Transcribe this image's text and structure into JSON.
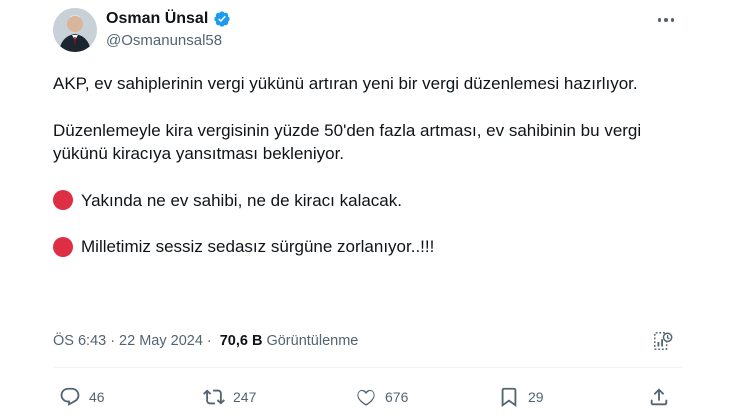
{
  "author": {
    "name": "Osman Ünsal",
    "handle": "@Osmanunsal58"
  },
  "tweet": {
    "paragraphs": [
      "AKP, ev sahiplerinin vergi yükünü artıran yeni bir vergi düzenlemesi hazırlıyor.",
      "Düzenlemeyle kira vergisinin yüzde 50'den fazla artması, ev sahibinin bu vergi yükünü kiracıya yansıtması bekleniyor."
    ],
    "bullets": [
      "Yakında ne ev sahibi, ne de kiracı kalacak.",
      "Milletimiz sessiz sedasız sürgüne zorlanıyor..!!!"
    ],
    "bullet_color": "#dd2e44"
  },
  "meta": {
    "time": "ÖS 6:43",
    "separator": "·",
    "date": "22 May 2024",
    "views_count": "70,6 B",
    "views_label": "Görüntülenme"
  },
  "actions": {
    "replies": "46",
    "retweets": "247",
    "likes": "676",
    "bookmarks": "29"
  },
  "icons": [
    "verified-badge-icon",
    "more-icon",
    "analytics-icon",
    "reply-icon",
    "retweet-icon",
    "like-icon",
    "bookmark-icon",
    "share-icon"
  ],
  "colors": {
    "verified": "#1d9bf0",
    "secondary_text": "#536471"
  }
}
